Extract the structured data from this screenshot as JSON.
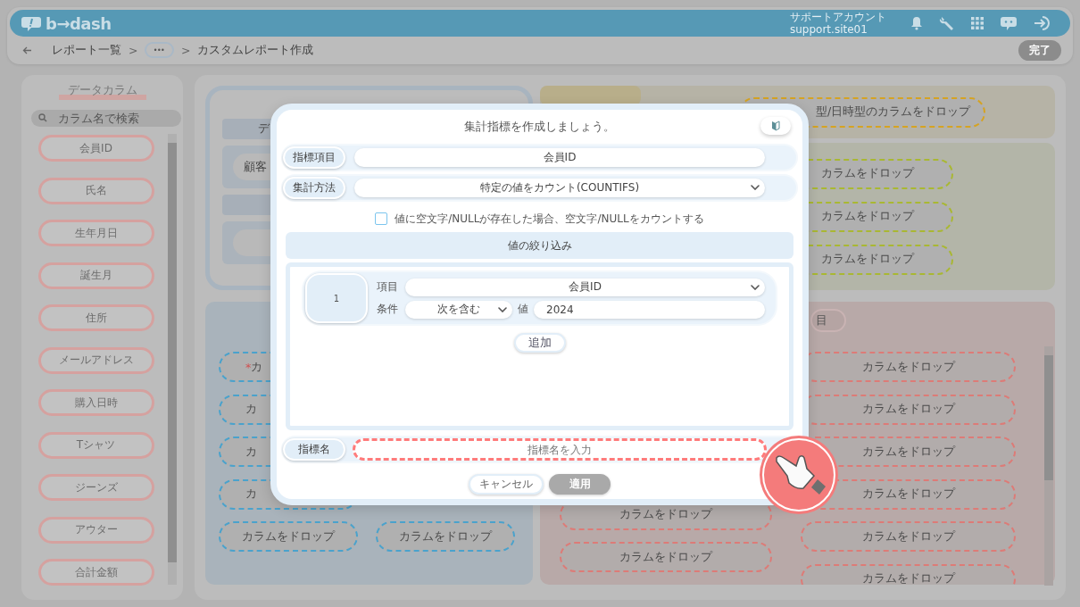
{
  "header": {
    "logo": "b→dash",
    "account_name": "サポートアカウント",
    "account_id": "support.site01"
  },
  "breadcrumb": [
    {
      "kind": "link",
      "label": "レポート一覧"
    },
    {
      "kind": "sep",
      "label": ">"
    },
    {
      "kind": "more",
      "label": "•••"
    },
    {
      "kind": "sep",
      "label": ">"
    },
    {
      "kind": "current",
      "label": "カスタムレポート作成"
    }
  ],
  "done_button": {
    "label": "完了",
    "disabled": true
  },
  "sidebar": {
    "title": "データカラム",
    "search_placeholder": "カラム名で検索",
    "items": [
      "会員ID",
      "氏名",
      "生年月日",
      "誕生月",
      "住所",
      "メールアドレス",
      "購入日時",
      "Tシャツ",
      "ジーンズ",
      "アウター",
      "合計金額"
    ]
  },
  "dimension_box": {
    "rows": [
      {
        "kind": "header",
        "text": "デ"
      },
      {
        "kind": "pill",
        "text": "顧客"
      },
      {
        "kind": "header"
      },
      {
        "kind": "pill"
      }
    ]
  },
  "date_drop": "型/日時型のカラムをドロップ",
  "green_drops": [
    "カラムをドロップ",
    "カラムをドロップ",
    "カラムをドロップ"
  ],
  "blue_drops_left": [
    {
      "text": "カ",
      "prefix": "*"
    },
    {
      "text": "カ"
    },
    {
      "text": "カ"
    },
    {
      "text": "カ"
    },
    {
      "text": "カラムをドロップ"
    }
  ],
  "blue_drops_right": [
    {
      "text": "カラムをドロップ"
    }
  ],
  "red_header": "目",
  "red_drops_left": [
    {
      "text": "カラムをドロップ"
    },
    {
      "text": "カラムをドロップ"
    }
  ],
  "red_drops_right": [
    {
      "text": "カラムをドロップ"
    },
    {
      "text": "カラムをドロップ"
    },
    {
      "text": "カラムをドロップ"
    },
    {
      "text": "カラムをドロップ"
    },
    {
      "text": "カラムをドロップ"
    },
    {
      "text": "カラムをドロップ"
    }
  ],
  "modal": {
    "title": "集計指標を作成しましょう。",
    "metric_item": {
      "label": "指標項目",
      "value": "会員ID"
    },
    "aggregation": {
      "label": "集計方法",
      "value": "特定の値をカウント(COUNTIFS)"
    },
    "count_null": {
      "label": "値に空文字/NULLが存在した場合、空文字/NULLをカウントする",
      "checked": false
    },
    "filter_title": "値の絞り込み",
    "filters": [
      {
        "number": "1",
        "item_label": "項目",
        "item_value": "会員ID",
        "condition_label": "条件",
        "condition_value": "次を含む",
        "value_label": "値",
        "value": "2024"
      }
    ],
    "add_button": "追加",
    "name_field": {
      "label": "指標名",
      "placeholder": "指標名を入力",
      "highlighted": true
    },
    "buttons": [
      {
        "label": "キャンセル",
        "disabled": false
      },
      {
        "label": "適用",
        "disabled": true
      }
    ]
  }
}
